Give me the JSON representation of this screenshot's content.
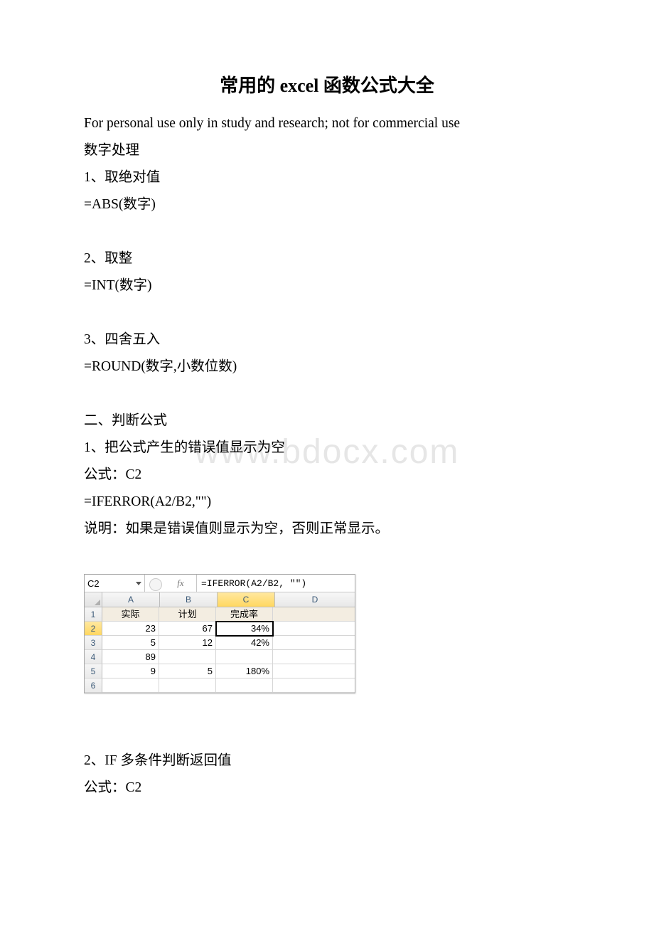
{
  "title": "常用的 excel 函数公式大全",
  "watermark": "www.bdocx.com",
  "lines": {
    "disclaimer": "For personal use only in study and research; not for commercial use",
    "s1": "数字处理",
    "s1_1": "1、取绝对值",
    "s1_1f": "=ABS(数字)",
    "s1_2": "2、取整",
    "s1_2f": "=INT(数字)",
    "s1_3": "3、四舍五入",
    "s1_3f": "=ROUND(数字,小数位数)",
    "s2": "二、判断公式",
    "s2_1": "1、把公式产生的错误值显示为空",
    "s2_1a": "公式：C2",
    "s2_1b": "=IFERROR(A2/B2,\"\")",
    "s2_1c": "说明：如果是错误值则显示为空，否则正常显示。",
    "s2_2": "2、IF 多条件判断返回值",
    "s2_2a": "公式：C2"
  },
  "excel": {
    "nameBox": "C2",
    "fxLabel": "fx",
    "formula": "=IFERROR(A2/B2, \"\")",
    "cols": [
      "A",
      "B",
      "C",
      "D"
    ],
    "headers": {
      "A": "实际",
      "B": "计划",
      "C": "完成率"
    },
    "rows": [
      {
        "n": "1",
        "A": "实际",
        "B": "计划",
        "C": "完成率",
        "D": "",
        "isHeader": true
      },
      {
        "n": "2",
        "A": "23",
        "B": "67",
        "C": "34%",
        "D": "",
        "sel": true
      },
      {
        "n": "3",
        "A": "5",
        "B": "12",
        "C": "42%",
        "D": ""
      },
      {
        "n": "4",
        "A": "89",
        "B": "",
        "C": "",
        "D": ""
      },
      {
        "n": "5",
        "A": "9",
        "B": "5",
        "C": "180%",
        "D": ""
      },
      {
        "n": "6",
        "A": "",
        "B": "",
        "C": "",
        "D": ""
      }
    ]
  }
}
